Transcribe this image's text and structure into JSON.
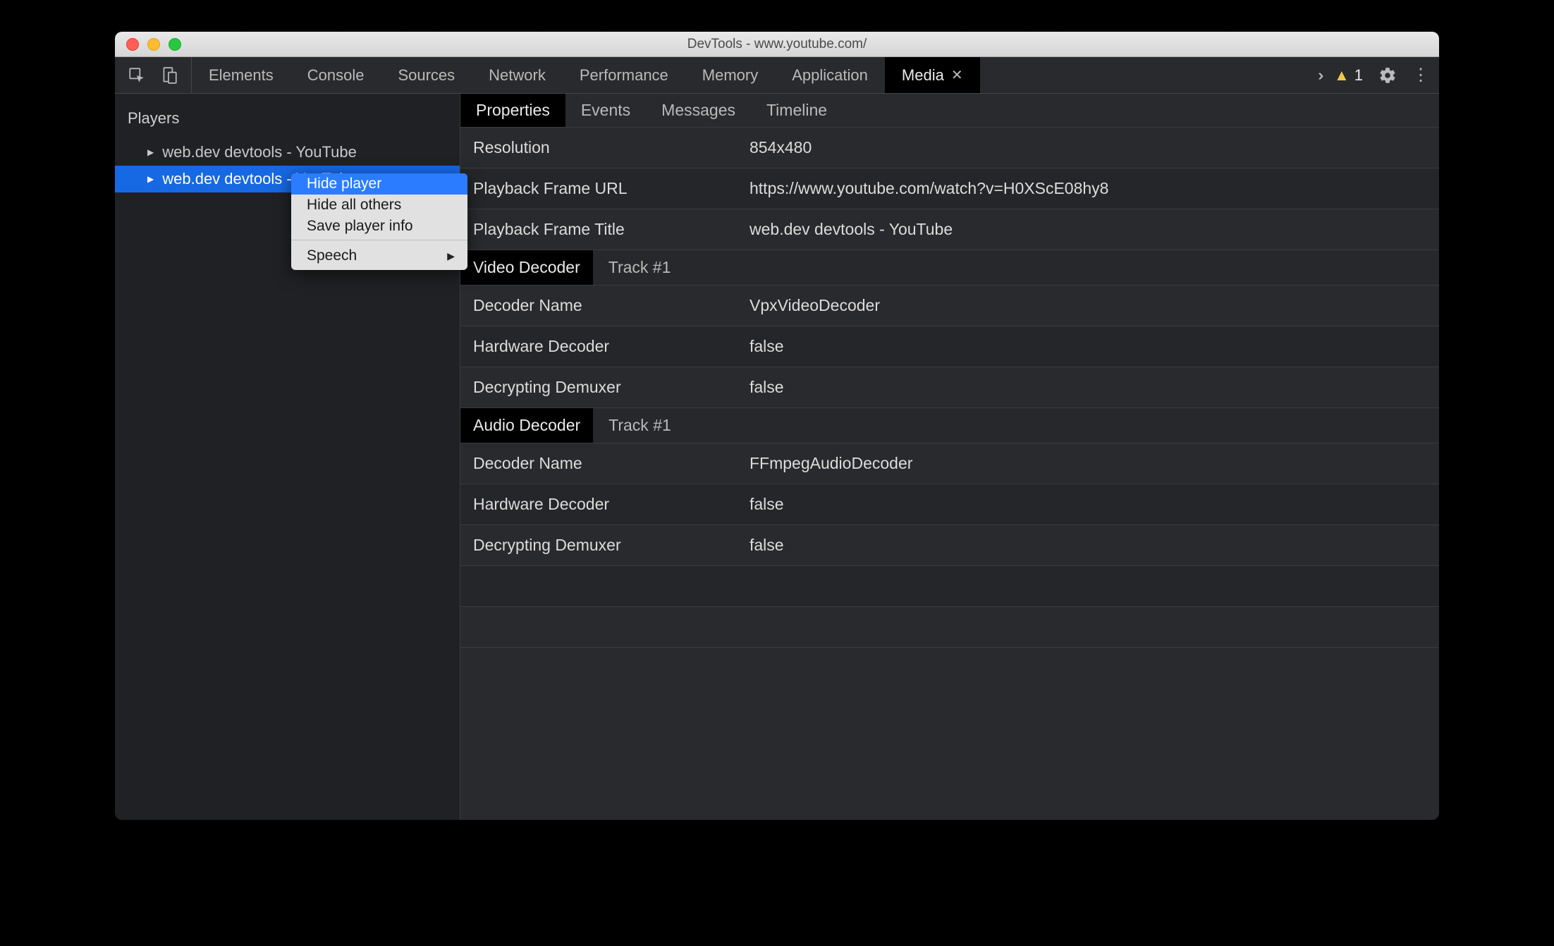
{
  "window": {
    "title": "DevTools - www.youtube.com/"
  },
  "toolbar": {
    "tabs": [
      "Elements",
      "Console",
      "Sources",
      "Network",
      "Performance",
      "Memory",
      "Application",
      "Media"
    ],
    "active_tab": "Media",
    "warning_count": "1"
  },
  "sidebar": {
    "title": "Players",
    "items": [
      {
        "label": "web.dev devtools - YouTube"
      },
      {
        "label": "web.dev devtools - YouTube"
      }
    ]
  },
  "context_menu": {
    "items": [
      "Hide player",
      "Hide all others",
      "Save player info"
    ],
    "submenu": "Speech"
  },
  "subtabs": {
    "items": [
      "Properties",
      "Events",
      "Messages",
      "Timeline"
    ],
    "active": "Properties"
  },
  "properties": {
    "general": [
      {
        "k": "Resolution",
        "v": "854x480"
      },
      {
        "k": "Playback Frame URL",
        "v": "https://www.youtube.com/watch?v=H0XScE08hy8"
      },
      {
        "k": "Playback Frame Title",
        "v": "web.dev devtools - YouTube"
      }
    ],
    "video_decoder": {
      "title": "Video Decoder",
      "track": "Track #1",
      "rows": [
        {
          "k": "Decoder Name",
          "v": "VpxVideoDecoder"
        },
        {
          "k": "Hardware Decoder",
          "v": "false"
        },
        {
          "k": "Decrypting Demuxer",
          "v": "false"
        }
      ]
    },
    "audio_decoder": {
      "title": "Audio Decoder",
      "track": "Track #1",
      "rows": [
        {
          "k": "Decoder Name",
          "v": "FFmpegAudioDecoder"
        },
        {
          "k": "Hardware Decoder",
          "v": "false"
        },
        {
          "k": "Decrypting Demuxer",
          "v": "false"
        }
      ]
    }
  }
}
